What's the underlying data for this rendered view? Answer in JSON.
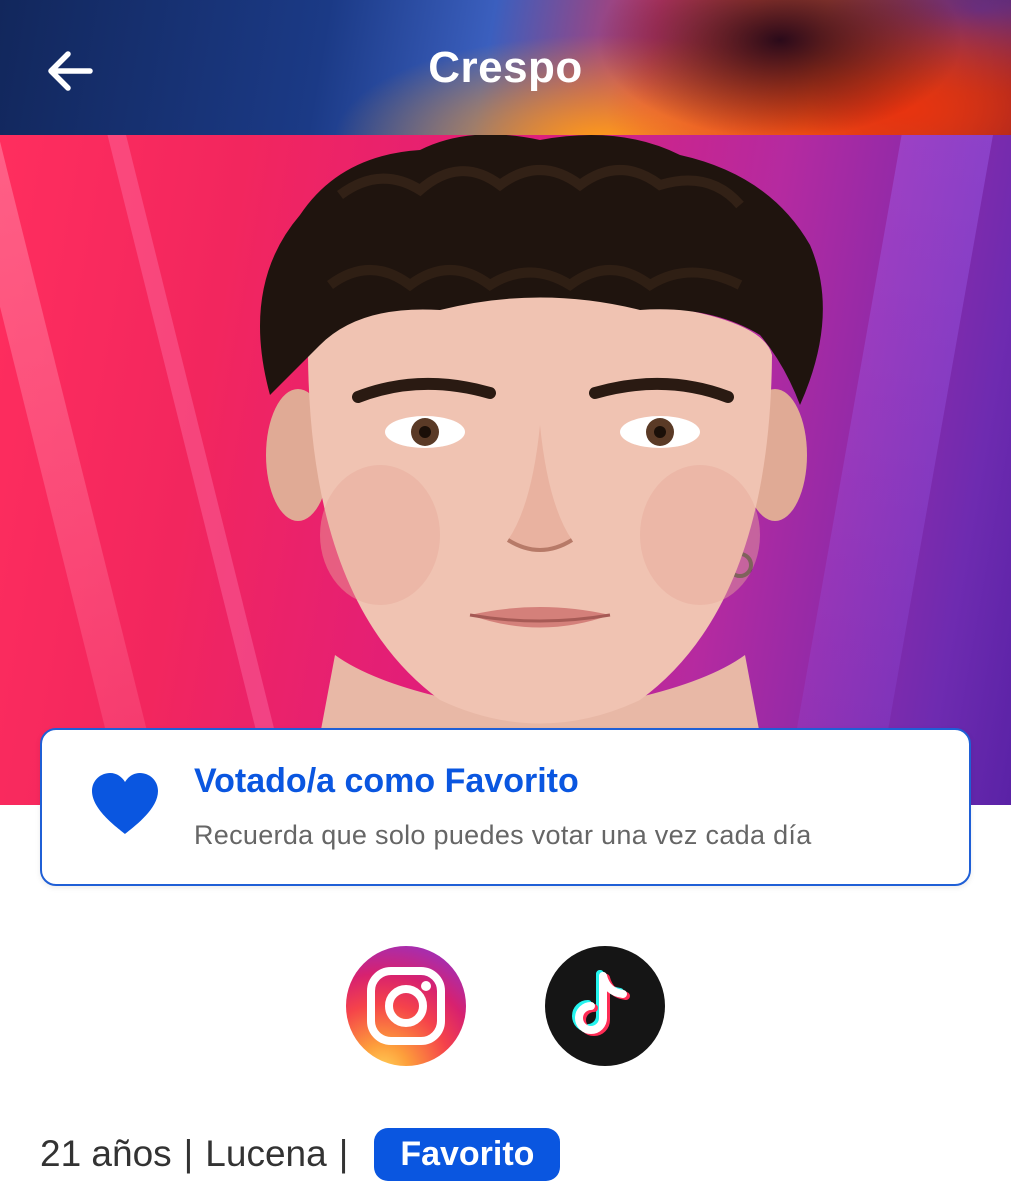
{
  "header": {
    "title": "Crespo",
    "back_icon": "arrow-left-icon"
  },
  "hero": {
    "image": "contestant-portrait"
  },
  "vote_card": {
    "icon": "heart-icon",
    "title": "Votado/a como Favorito",
    "subtitle": "Recuerda que solo puedes votar una vez cada día"
  },
  "social": {
    "instagram_icon": "instagram-icon",
    "tiktok_icon": "tiktok-icon"
  },
  "info": {
    "age": "21 años",
    "separator": "|",
    "city": "Lucena",
    "badge": "Favorito"
  },
  "colors": {
    "accent": "#0a56e0",
    "card_border": "#1f5fd6",
    "text_dark": "#333333",
    "text_muted": "#666666"
  }
}
